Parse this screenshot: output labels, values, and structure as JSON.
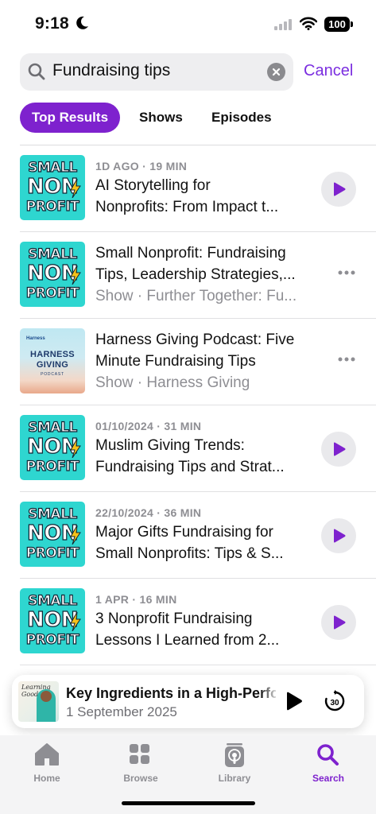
{
  "status_bar": {
    "time": "9:18",
    "battery": "100"
  },
  "search": {
    "query": "Fundraising tips",
    "cancel_label": "Cancel"
  },
  "tabs": [
    {
      "label": "Top Results",
      "active": true
    },
    {
      "label": "Shows",
      "active": false
    },
    {
      "label": "Episodes",
      "active": false
    }
  ],
  "artwork": {
    "small_nonprofit": {
      "line1": "SMALL",
      "line2": "NON",
      "line3": "PROFIT"
    },
    "harness_giving": {
      "logo": "Harness",
      "line1": "HARNESS",
      "line2": "GIVING",
      "line3": "PODCAST"
    },
    "learning": {
      "line1": "Learning",
      "line2": "Good"
    }
  },
  "results": [
    {
      "kind": "episode",
      "meta": "1D AGO · 19 MIN",
      "line1": "AI Storytelling for",
      "line2": "Nonprofits: From Impact t..."
    },
    {
      "kind": "show",
      "line1": "Small Nonprofit: Fundraising",
      "line2": "Tips, Leadership Strategies,...",
      "sub": "Show · Further Together: Fu..."
    },
    {
      "kind": "show",
      "line1": "Harness Giving Podcast: Five",
      "line2": "Minute Fundraising Tips",
      "sub": "Show · Harness Giving"
    },
    {
      "kind": "episode",
      "meta": "01/10/2024 · 31 MIN",
      "line1": "Muslim Giving Trends:",
      "line2": "Fundraising Tips and Strat..."
    },
    {
      "kind": "episode",
      "meta": "22/10/2024 · 36 MIN",
      "line1": "Major Gifts Fundraising for",
      "line2": "Small Nonprofits: Tips & S..."
    },
    {
      "kind": "episode",
      "meta": "1 APR · 16 MIN",
      "line1": "3 Nonprofit Fundraising",
      "line2": "Lessons I Learned from 2..."
    }
  ],
  "mini_player": {
    "title": "Key Ingredients in a High-Performing",
    "date": "1 September 2025",
    "skip_seconds": "30"
  },
  "tab_bar": [
    {
      "label": "Home",
      "icon": "home-icon"
    },
    {
      "label": "Browse",
      "icon": "grid-icon"
    },
    {
      "label": "Library",
      "icon": "library-icon"
    },
    {
      "label": "Search",
      "icon": "search-icon",
      "active": true
    }
  ],
  "colors": {
    "accent": "#7e22ce",
    "cancel": "#7b2ee0",
    "art_teal": "#2ed6d0",
    "secondary_text": "#8e8e93"
  }
}
